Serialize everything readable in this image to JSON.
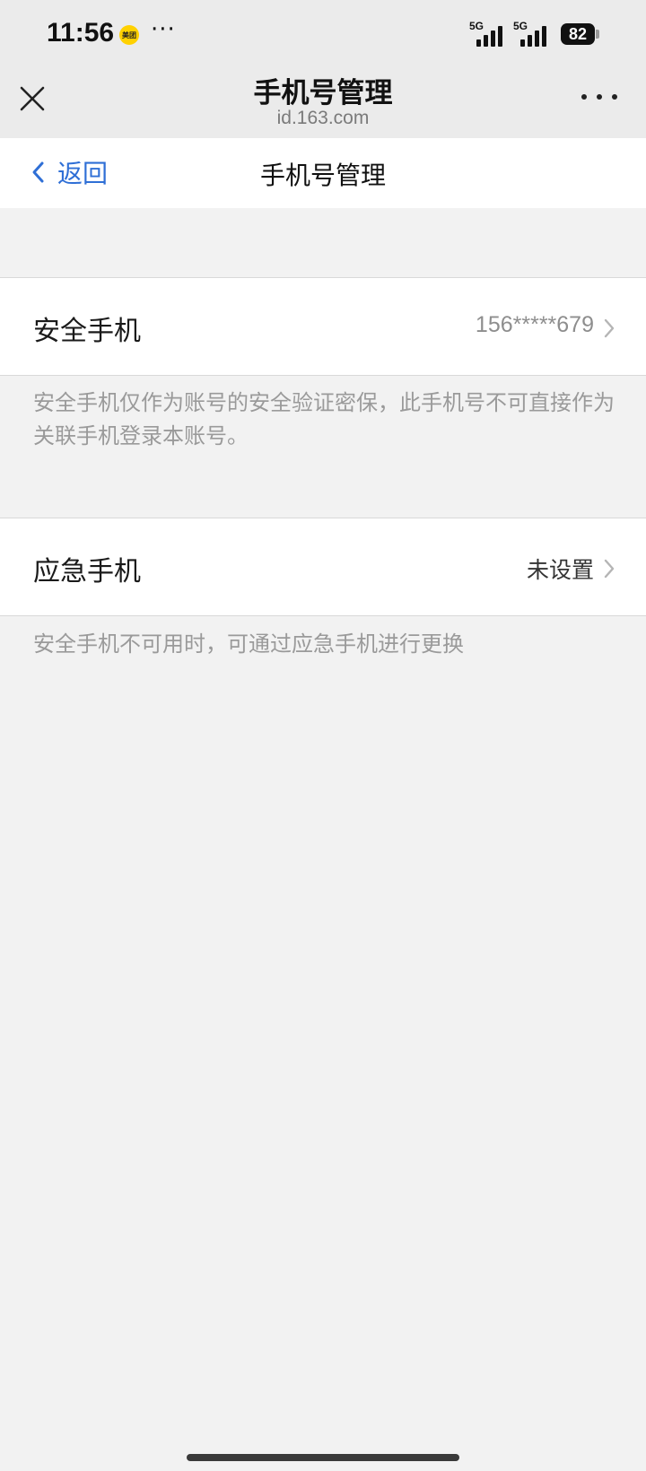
{
  "status_bar": {
    "time": "11:56",
    "app_badge": "美团",
    "more": "···",
    "signal1_label": "5G",
    "signal2_label": "5G",
    "battery": "82"
  },
  "browser": {
    "title": "手机号管理",
    "url": "id.163.com"
  },
  "header": {
    "back_label": "返回",
    "title": "手机号管理"
  },
  "security_phone": {
    "label": "安全手机",
    "value": "156*****679",
    "description": "安全手机仅作为账号的安全验证密保，此手机号不可直接作为关联手机登录本账号。"
  },
  "emergency_phone": {
    "label": "应急手机",
    "value": "未设置",
    "description": "安全手机不可用时，可通过应急手机进行更换"
  },
  "colors": {
    "accent": "#2f6fd6",
    "background": "#f2f2f2",
    "muted_text": "#9a9a9a"
  }
}
